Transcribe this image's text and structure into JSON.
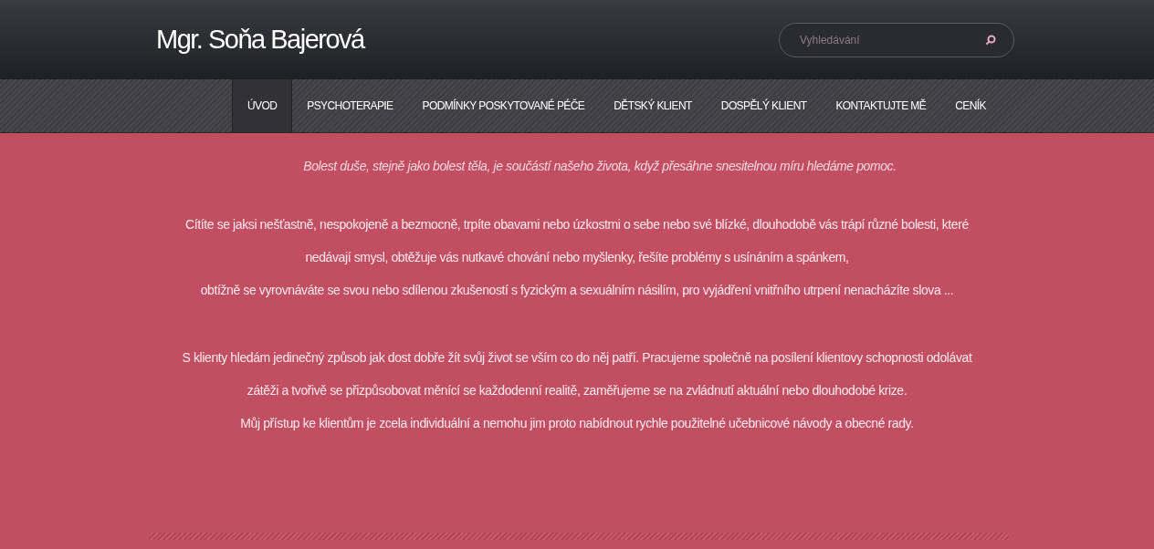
{
  "header": {
    "title": "Mgr. Soňa Bajerová",
    "search": {
      "placeholder": "Vyhledávání"
    }
  },
  "nav": [
    {
      "label": "ÚVOD",
      "selected": true
    },
    {
      "label": "PSYCHOTERAPIE",
      "selected": false
    },
    {
      "label": "PODMÍNKY POSKYTOVANÉ PÉČE",
      "selected": false
    },
    {
      "label": "DĚTSKÝ KLIENT",
      "selected": false
    },
    {
      "label": "DOSPĚLÝ KLIENT",
      "selected": false
    },
    {
      "label": "KONTAKTUJTE MĚ",
      "selected": false
    },
    {
      "label": "CENÍK",
      "selected": false
    }
  ],
  "content": {
    "quote": "Bolest duše, stejně jako bolest těla, je součástí našeho života, když přesáhne snesitelnou míru hledáme pomoc.",
    "paragraphs": [
      [
        "Cítíte se jaksi nešťastně, nespokojeně a bezmocně, trpíte obavami nebo úzkostmi o sebe nebo své blízké, dlouhodobě vás trápí různé bolesti, které",
        "nedávají smysl, obtěžuje vás nutkavé chování nebo myšlenky, řešíte problémy s usínáním a spánkem,",
        "obtížně se vyrovnáváte se svou nebo sdílenou zkušeností s fyzickým a sexuálním násilím, pro vyjádření vnitřního utrpení nenacházíte slova ..."
      ],
      [
        "S klienty hledám jedinečný způsob jak dost dobře žít svůj život se vším co do něj patří.  Pracujeme společně na posílení klientovy schopnosti odolávat",
        "zátěži a tvořivě se přizpůsobovat měnící se každodenní realitě, zaměřujeme se na zvládnutí aktuální nebo dlouhodobé krize.",
        "Můj přístup ke klientům je zcela individuální a nemohu jim proto nabídnout rychle použitelné učebnicové návody a obecné rady."
      ]
    ]
  }
}
